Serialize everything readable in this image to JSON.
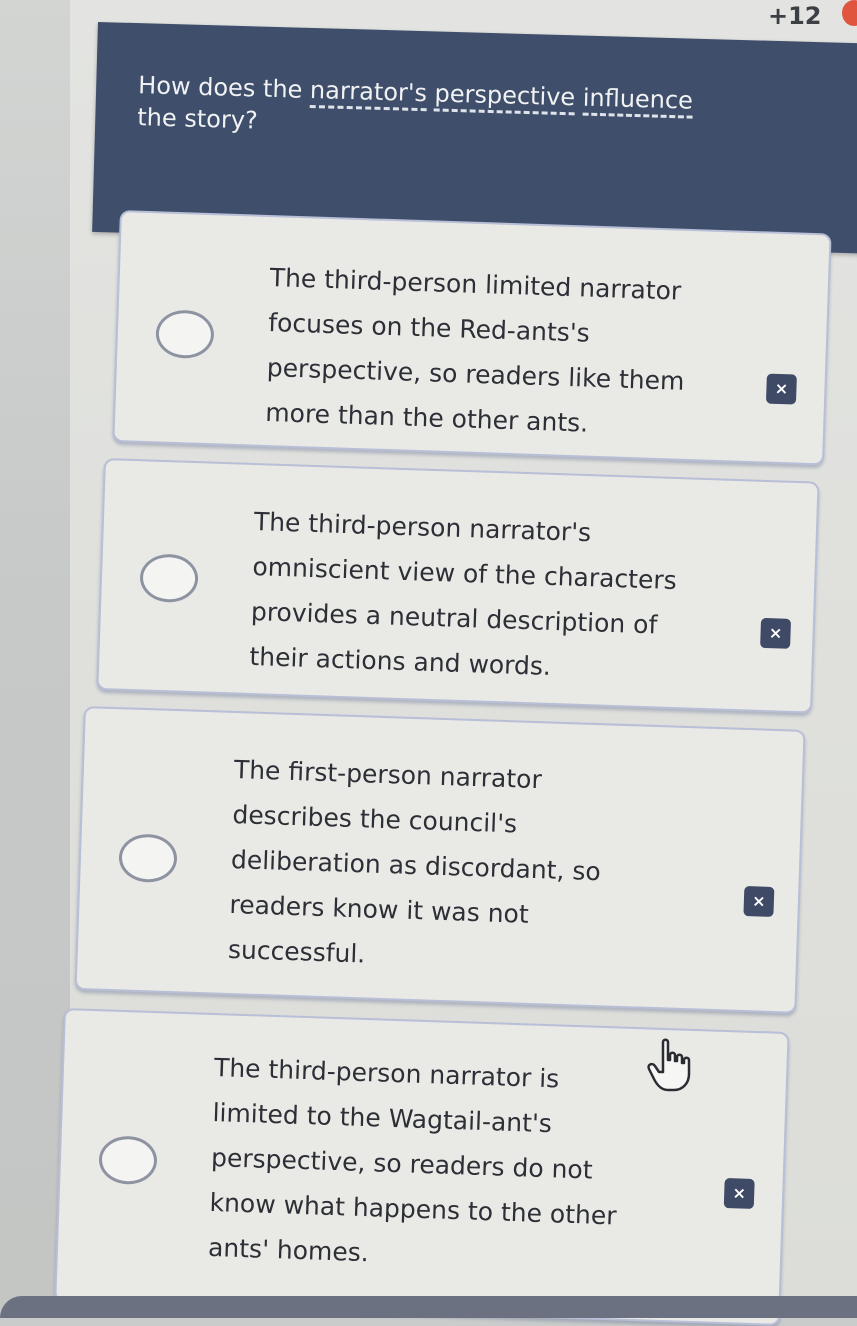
{
  "header": {
    "score": "+12",
    "score_dot_color": "#e0553d"
  },
  "question": {
    "parts": [
      "How does the ",
      "narrator's",
      " ",
      "perspective",
      " ",
      "influence",
      " the story?"
    ],
    "bar_color": "#3f4f6b"
  },
  "options": [
    {
      "lines": [
        "The third-person limited narrator",
        "focuses on the Red-ants's",
        "perspective, so readers like them",
        "more than the other ants."
      ],
      "remove_icon": "close-icon"
    },
    {
      "lines": [
        "The third-person narrator's",
        "omniscient view of the characters",
        "provides a neutral description of",
        "their actions and words."
      ],
      "remove_icon": "close-icon"
    },
    {
      "lines": [
        "The first-person narrator",
        "describes the council's",
        "deliberation as discordant, so",
        "readers know it was not",
        "successful."
      ],
      "remove_icon": "close-icon"
    },
    {
      "lines": [
        "The third-person narrator is",
        "limited to the Wagtail-ant's",
        "perspective, so readers do not",
        "know what happens to the other",
        "ants' homes."
      ],
      "remove_icon": "close-icon"
    }
  ],
  "icons": {
    "remove": "×",
    "cursor": "hand-pointer-icon"
  },
  "accent_color": "#3e4a66"
}
